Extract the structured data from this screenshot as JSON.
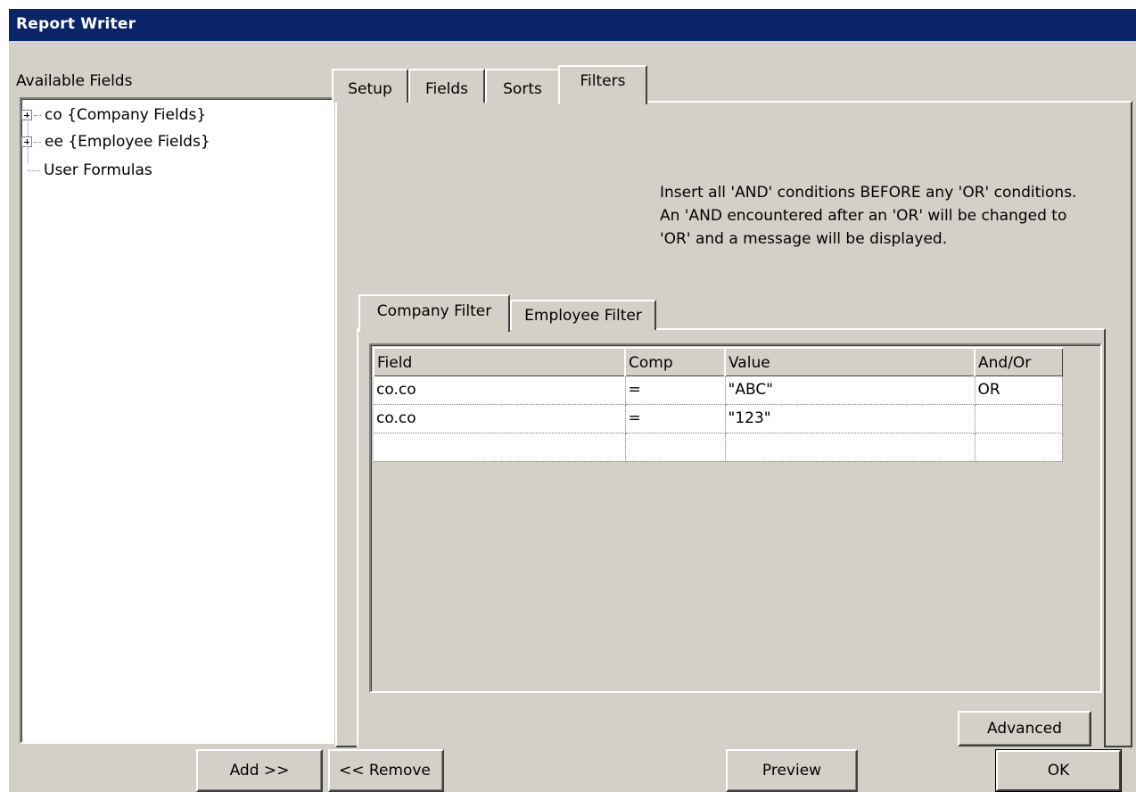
{
  "window": {
    "title": "Report Writer"
  },
  "available_fields": {
    "label": "Available Fields",
    "tree": [
      {
        "label": "co {Company Fields}",
        "expandable": true
      },
      {
        "label": "ee {Employee Fields}",
        "expandable": true
      },
      {
        "label": "User Formulas",
        "expandable": false
      }
    ]
  },
  "tabs": [
    "Setup",
    "Fields",
    "Sorts",
    "Filters"
  ],
  "active_tab": "Filters",
  "filters": {
    "note": "Insert all 'AND' conditions BEFORE any 'OR' conditions. An 'AND encountered after an 'OR' will be changed to 'OR' and a message will be displayed.",
    "subtabs": [
      "Company Filter",
      "Employee Filter"
    ],
    "active_subtab": "Company Filter",
    "grid": {
      "columns": [
        "Field",
        "Comp",
        "Value",
        "And/Or"
      ],
      "rows": [
        [
          "co.co",
          "=",
          "\"ABC\"",
          "OR"
        ],
        [
          "co.co",
          "=",
          "\"123\"",
          ""
        ],
        [
          "",
          "",
          "",
          ""
        ]
      ]
    },
    "advanced_label": "Advanced"
  },
  "buttons": {
    "add": "Add >>",
    "remove": "<< Remove",
    "preview": "Preview",
    "ok": "OK"
  },
  "colors": {
    "titlebar": "#0a246a",
    "face": "#d4d0c8"
  }
}
